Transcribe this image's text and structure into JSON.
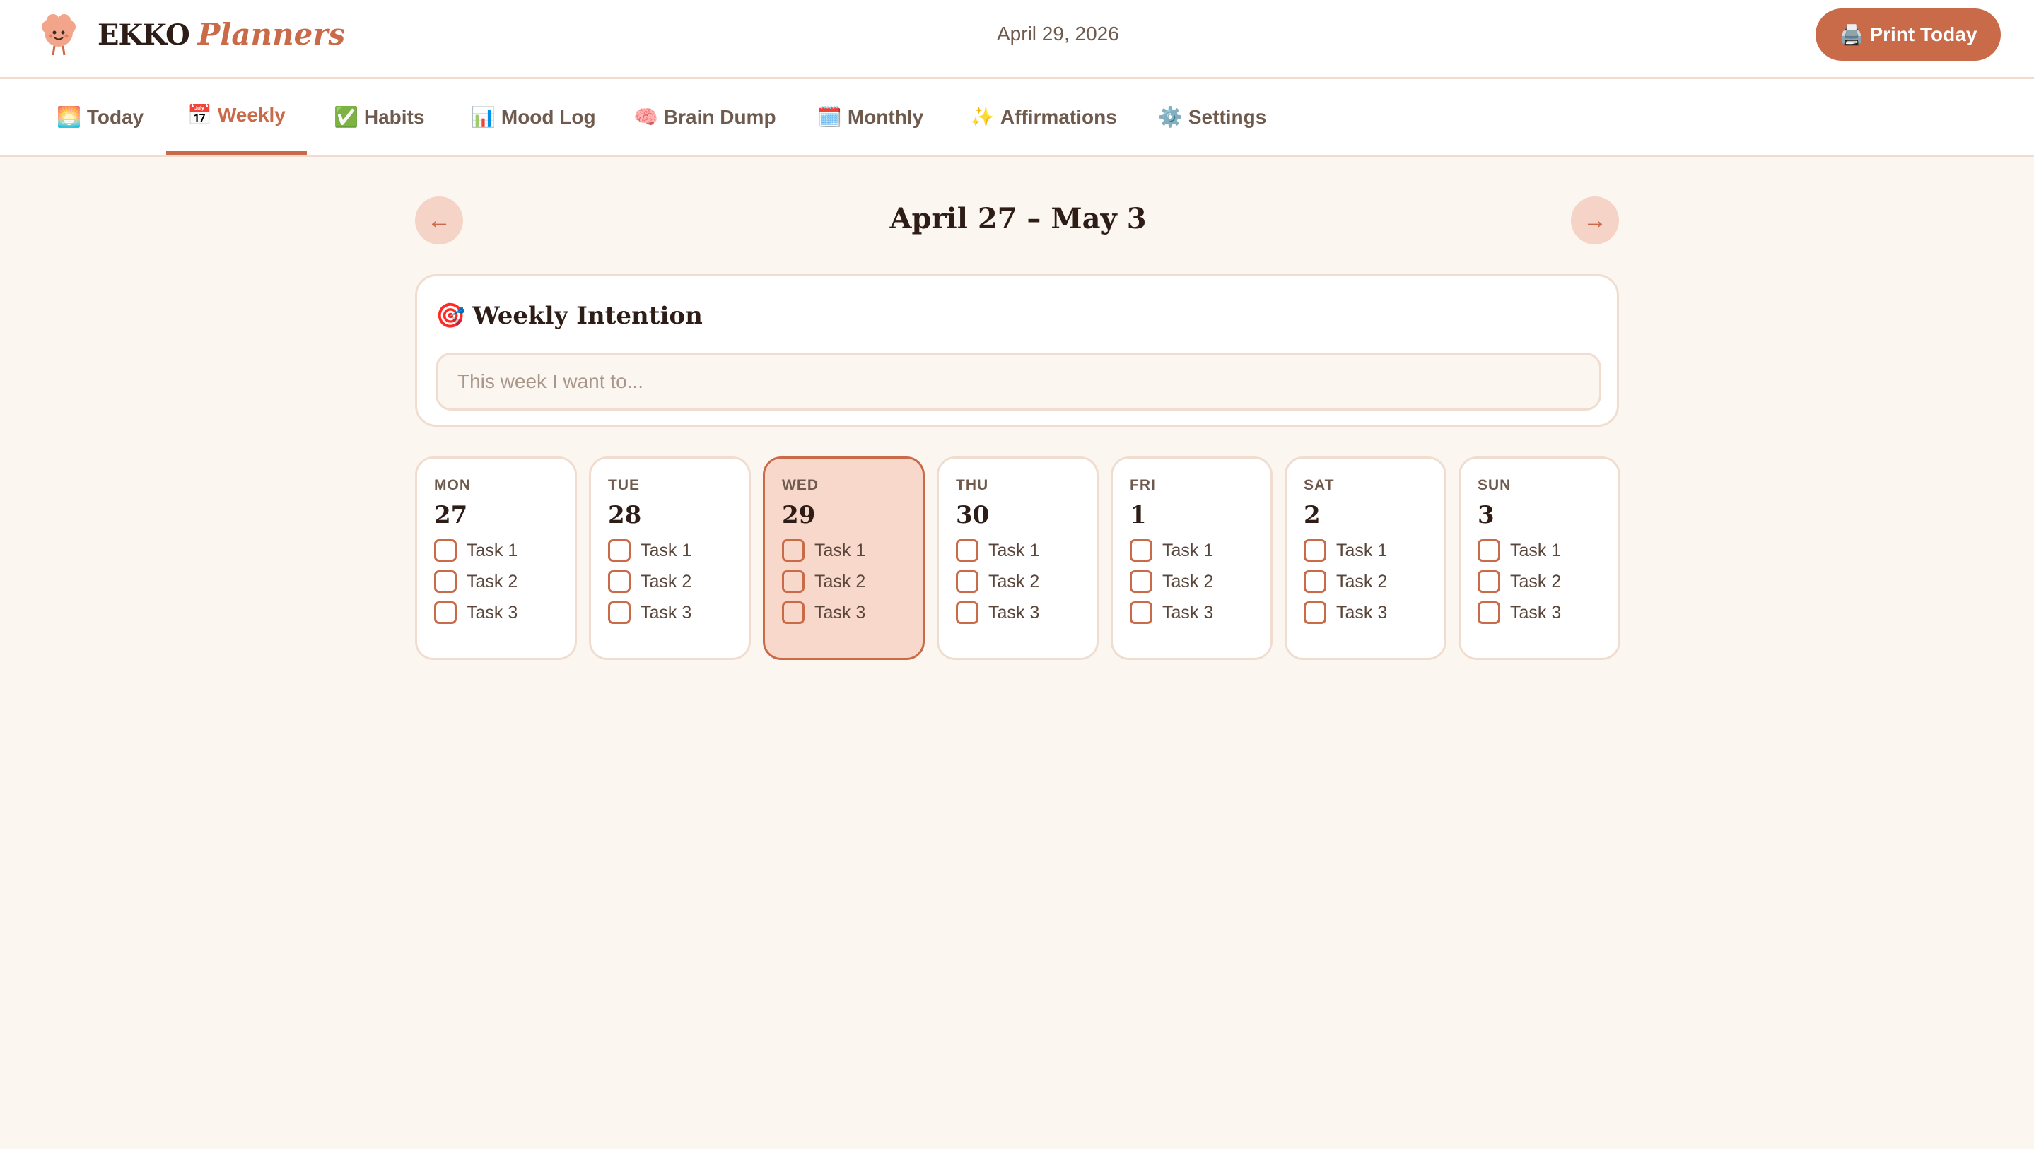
{
  "header": {
    "brand_main": "EKKO",
    "brand_sub": "Planners",
    "date": "April 29, 2026",
    "print_label": "Print Today",
    "print_icon": "🖨️"
  },
  "tabs": [
    {
      "icon": "🌅",
      "label": "Today"
    },
    {
      "icon": "📅",
      "label": "Weekly"
    },
    {
      "icon": "✅",
      "label": "Habits"
    },
    {
      "icon": "📊",
      "label": "Mood Log"
    },
    {
      "icon": "🧠",
      "label": "Brain Dump"
    },
    {
      "icon": "🗓️",
      "label": "Monthly"
    },
    {
      "icon": "✨",
      "label": "Affirmations"
    },
    {
      "icon": "⚙️",
      "label": "Settings"
    }
  ],
  "active_tab": "Weekly",
  "week": {
    "title": "April 27 – May 3",
    "prev_icon": "←",
    "next_icon": "→"
  },
  "intention": {
    "icon": "🎯",
    "title": "Weekly Intention",
    "value": "",
    "placeholder": "This week I want to..."
  },
  "days": [
    {
      "name": "MON",
      "num": "27",
      "tasks": [
        "Task 1",
        "Task 2",
        "Task 3"
      ]
    },
    {
      "name": "TUE",
      "num": "28",
      "tasks": [
        "Task 1",
        "Task 2",
        "Task 3"
      ]
    },
    {
      "name": "WED",
      "num": "29",
      "tasks": [
        "Task 1",
        "Task 2",
        "Task 3"
      ],
      "today": true
    },
    {
      "name": "THU",
      "num": "30",
      "tasks": [
        "Task 1",
        "Task 2",
        "Task 3"
      ]
    },
    {
      "name": "FRI",
      "num": "1",
      "tasks": [
        "Task 1",
        "Task 2",
        "Task 3"
      ]
    },
    {
      "name": "SAT",
      "num": "2",
      "tasks": [
        "Task 1",
        "Task 2",
        "Task 3"
      ]
    },
    {
      "name": "SUN",
      "num": "3",
      "tasks": [
        "Task 1",
        "Task 2",
        "Task 3"
      ]
    }
  ],
  "colors": {
    "accent": "#c96a48",
    "background": "#fcf6f0",
    "today_fill": "#f7d8cb"
  }
}
